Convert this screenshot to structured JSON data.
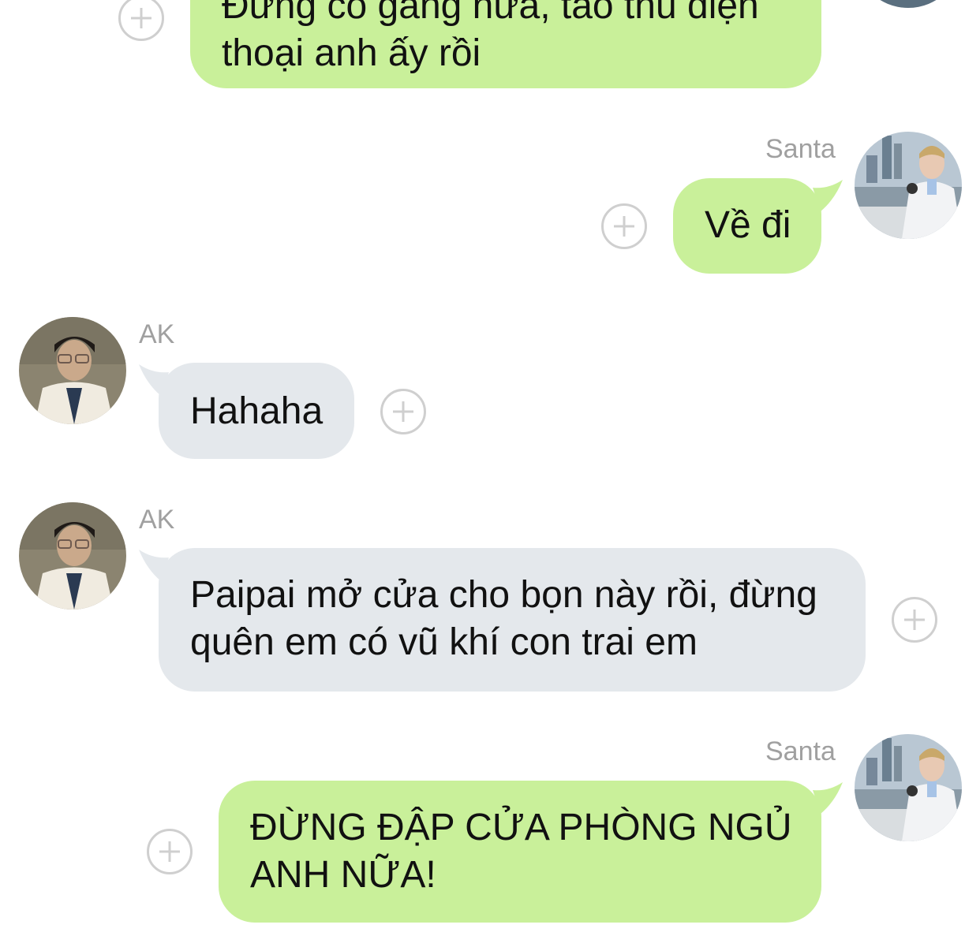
{
  "messages": [
    {
      "sender": "",
      "text": "Đừng cố gắng nữa, tao thu điện\nthoại anh ấy rồi",
      "side": "sent"
    },
    {
      "sender": "Santa",
      "text": "Về đi",
      "side": "sent"
    },
    {
      "sender": "AK",
      "text": "Hahaha",
      "side": "received"
    },
    {
      "sender": "AK",
      "text": "Paipai mở cửa cho bọn này rồi, đừng\nquên em có vũ khí con trai em",
      "side": "received"
    },
    {
      "sender": "Santa",
      "text": "ĐỪNG ĐẬP CỬA PHÒNG NGỦ\nANH NỮA!",
      "side": "sent"
    }
  ],
  "colors": {
    "sent_bubble": "#c9f09a",
    "received_bubble": "#e4e8ec",
    "name_text": "#a0a0a0",
    "plus_icon": "#cfcfcf"
  },
  "icons": {
    "react": "plus-circle-icon",
    "santa_avatar": "avatar-photo",
    "ak_avatar": "avatar-photo"
  }
}
